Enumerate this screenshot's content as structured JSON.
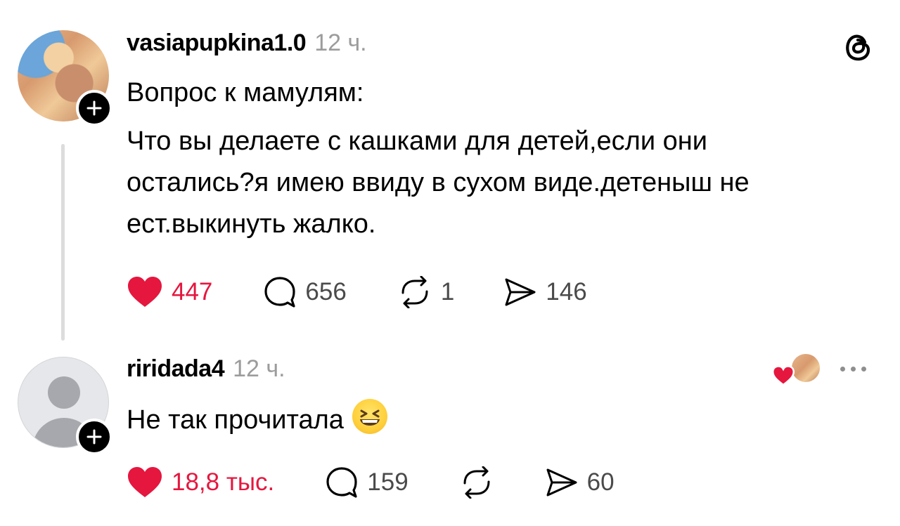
{
  "post": {
    "username": "vasiapupkina1.0",
    "time": "12 ч.",
    "lines": [
      "Вопрос к мамулям:",
      "Что вы делаете с кашками для детей,если они",
      "остались?я имею ввиду в сухом виде.детеныш не",
      "ест.выкинуть жалко."
    ],
    "likes": "447",
    "comments": "656",
    "reposts": "1",
    "shares": "146"
  },
  "reply": {
    "username": "riridada4",
    "time": "12 ч.",
    "text": "Не так прочитала",
    "likes": "18,8 тыс.",
    "comments": "159",
    "shares": "60"
  },
  "icons": {
    "app_logo": "threads-logo-icon",
    "follow": "plus-icon",
    "like": "heart-icon",
    "comment": "comment-bubble-icon",
    "repost": "repost-icon",
    "share": "send-icon",
    "more": "more-dots-icon",
    "emoji": "grinning-squinting-face-emoji"
  },
  "colors": {
    "like_red": "#e5173f",
    "time_gray": "#9c9c9c",
    "count_gray": "#4a4a4a",
    "thread_line": "#dcdcdc"
  }
}
